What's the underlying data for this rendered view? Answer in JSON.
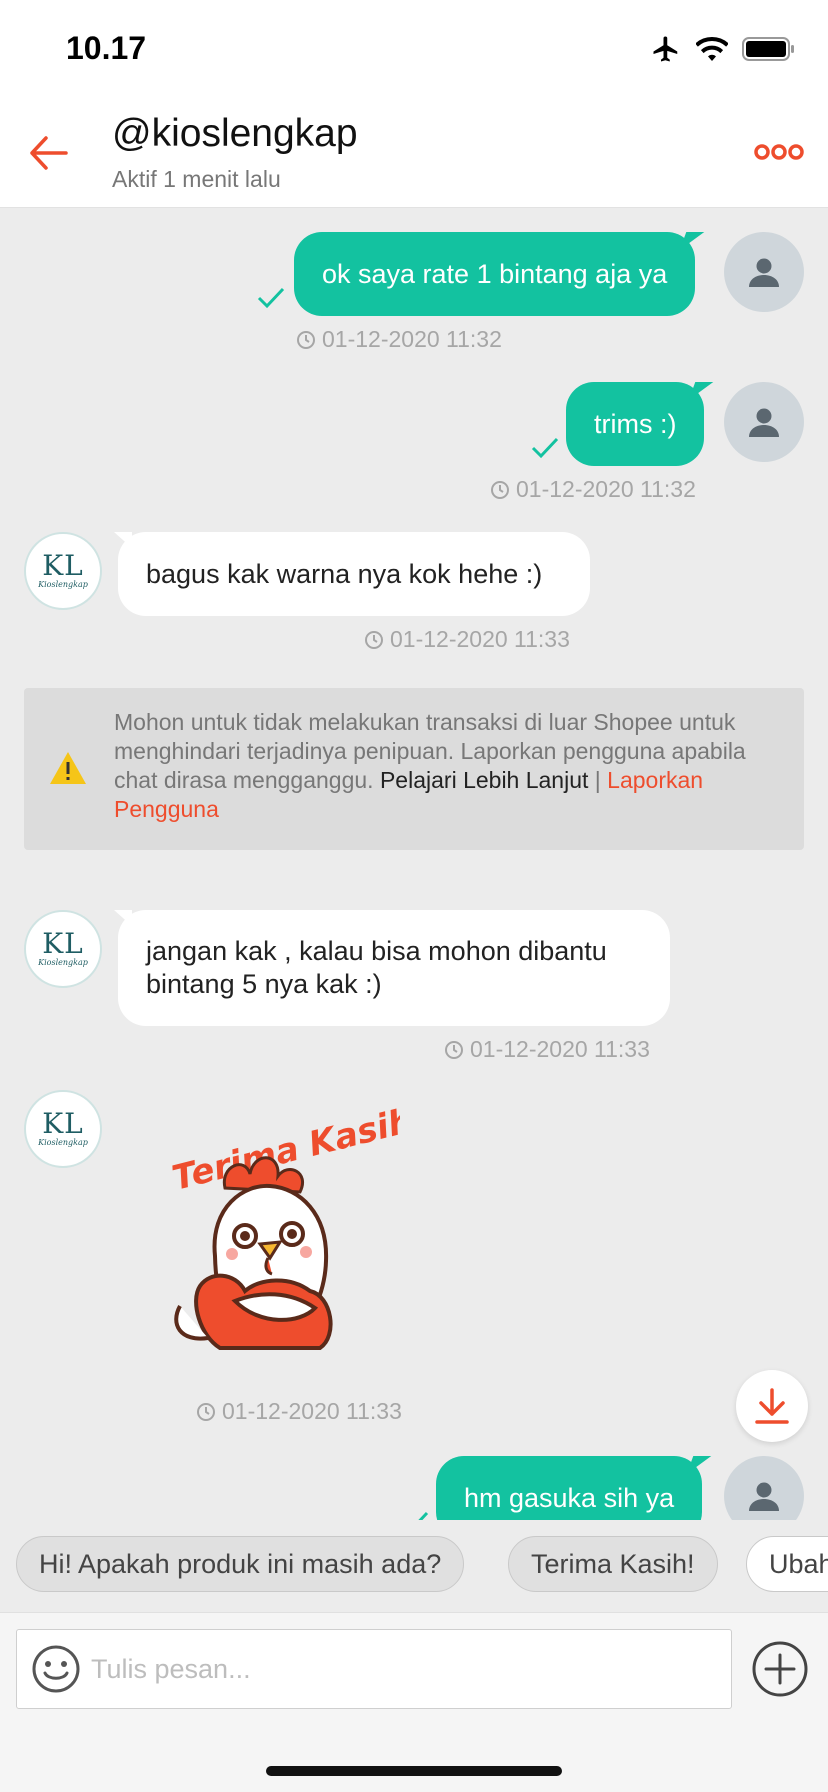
{
  "status_bar": {
    "time": "10.17",
    "icons": [
      "airplane-icon",
      "wifi-icon",
      "battery-icon"
    ]
  },
  "header": {
    "back_icon": "arrow-left-icon",
    "title": "@kioslengkap",
    "subtitle": "Aktif 1 menit lalu",
    "more_icon": "more-dots-icon"
  },
  "colors": {
    "accent": "#ee4d2d",
    "bubble_out": "#13c2a0",
    "bubble_in": "#ffffff",
    "chat_bg": "#ececec"
  },
  "shop_avatar": {
    "initials": "KL",
    "name": "Kioslengkap"
  },
  "messages": [
    {
      "side": "out",
      "text": "ok saya rate 1 bintang aja ya",
      "time": "01-12-2020 11:32",
      "read": true
    },
    {
      "side": "out",
      "text": "trims :)",
      "time": "01-12-2020 11:32",
      "read": true
    },
    {
      "side": "in",
      "text": "bagus kak warna nya kok hehe :)",
      "time": "01-12-2020 11:33"
    },
    {
      "side": "in",
      "text": "jangan kak , kalau bisa mohon dibantu bintang 5 nya kak :)",
      "time": "01-12-2020 11:33"
    },
    {
      "side": "in",
      "type": "sticker",
      "sticker_text": "Terima Kasih!",
      "time": "01-12-2020 11:33"
    },
    {
      "side": "out",
      "text": "hm gasuka sih ya"
    }
  ],
  "warning": {
    "text": "Mohon untuk tidak melakukan transaksi di luar Shopee untuk menghindari terjadinya penipuan. Laporkan pengguna apabila chat dirasa mengganggu.",
    "learn_more": "Pelajari Lebih Lanjut",
    "separator": "|",
    "report": "Laporkan Pengguna"
  },
  "quick_replies": [
    "Hi! Apakah produk ini masih ada?",
    "Terima Kasih!",
    "Ubah"
  ],
  "input": {
    "placeholder": "Tulis pesan...",
    "value": ""
  }
}
